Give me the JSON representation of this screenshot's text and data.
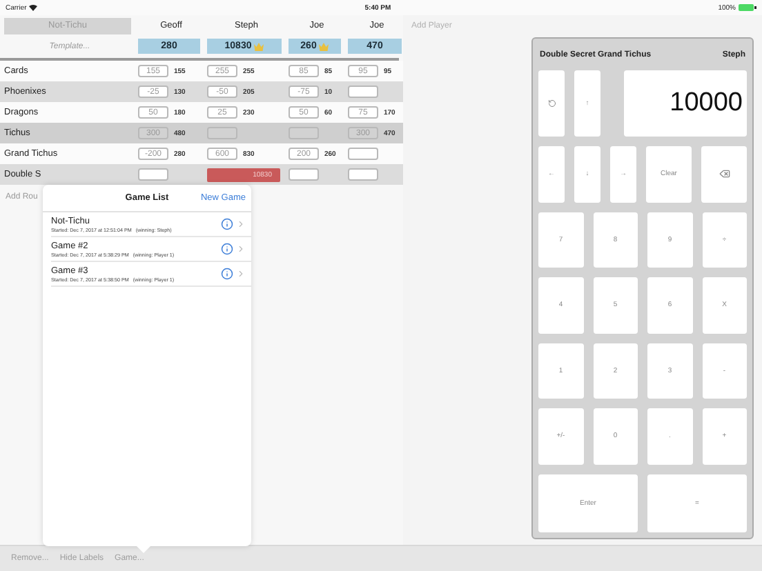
{
  "status_bar": {
    "carrier": "Carrier",
    "time": "5:40 PM",
    "battery": "100%"
  },
  "header": {
    "game_button": "Not-Tichu",
    "template": "Template...",
    "add_player": "Add Player"
  },
  "players": [
    {
      "name": "Geoff",
      "score": "280",
      "leader": false
    },
    {
      "name": "Steph",
      "score": "10830",
      "leader": true
    },
    {
      "name": "Joe",
      "score": "260",
      "leader": true
    },
    {
      "name": "Joe",
      "score": "470",
      "leader": false
    }
  ],
  "rows": [
    {
      "label": "Cards",
      "shaded": false,
      "cells": [
        {
          "input": "155",
          "total": "155"
        },
        {
          "input": "255",
          "total": "255"
        },
        {
          "input": "85",
          "total": "85"
        },
        {
          "input": "95",
          "total": "95"
        }
      ]
    },
    {
      "label": "Phoenixes",
      "shaded": true,
      "cells": [
        {
          "input": "-25",
          "total": "130"
        },
        {
          "input": "-50",
          "total": "205"
        },
        {
          "input": "-75",
          "total": "10"
        },
        {}
      ]
    },
    {
      "label": "Dragons",
      "shaded": false,
      "cells": [
        {
          "input": "50",
          "total": "180"
        },
        {
          "input": "25",
          "total": "230"
        },
        {
          "input": "50",
          "total": "60"
        },
        {
          "input": "75",
          "total": "170"
        }
      ]
    },
    {
      "label": "Tichus",
      "shaded": true,
      "cells": [
        {
          "input": "300",
          "total": "480"
        },
        {},
        {},
        {
          "input": "300",
          "total": "470"
        }
      ]
    },
    {
      "label": "Grand Tichus",
      "shaded": false,
      "cells": [
        {
          "input": "-200",
          "total": "280"
        },
        {
          "input": "600",
          "total": "830"
        },
        {
          "input": "200",
          "total": "260"
        },
        {}
      ]
    },
    {
      "label": "Double S",
      "shaded": true,
      "cells": [
        {},
        {
          "total": "10830",
          "highlighted": true
        },
        {},
        {}
      ]
    }
  ],
  "add_round": "Add Rou",
  "game_list": {
    "title": "Game List",
    "new_game": "New Game",
    "games": [
      {
        "name": "Not-Tichu",
        "detail": "Started: Dec 7, 2017 at 12:51:04 PM   (winning: Steph)"
      },
      {
        "name": "Game #2",
        "detail": "Started: Dec 7, 2017 at 5:38:29 PM   (winning: Player 1)"
      },
      {
        "name": "Game #3",
        "detail": "Started: Dec 7, 2017 at 5:38:50 PM   (winning: Player 1)"
      }
    ]
  },
  "calculator": {
    "title": "Double Secret Grand Tichus",
    "player": "Steph",
    "display": "10000",
    "top_keys": [
      {
        "kind": "undo"
      },
      {
        "kind": "text",
        "label": "↑"
      }
    ],
    "arrow_keys": [
      {
        "kind": "text",
        "label": "←"
      },
      {
        "kind": "text",
        "label": "↓"
      },
      {
        "kind": "text",
        "label": "→"
      },
      {
        "kind": "text",
        "label": "Clear"
      },
      {
        "kind": "backspace"
      }
    ],
    "key_rows": [
      [
        "7",
        "8",
        "9",
        "÷"
      ],
      [
        "4",
        "5",
        "6",
        "X"
      ],
      [
        "1",
        "2",
        "3",
        "-"
      ],
      [
        "+/-",
        "0",
        ".",
        "+"
      ],
      [
        "Enter",
        "="
      ]
    ]
  },
  "toolbar": [
    "Remove...",
    "Hide Labels",
    "Game..."
  ]
}
